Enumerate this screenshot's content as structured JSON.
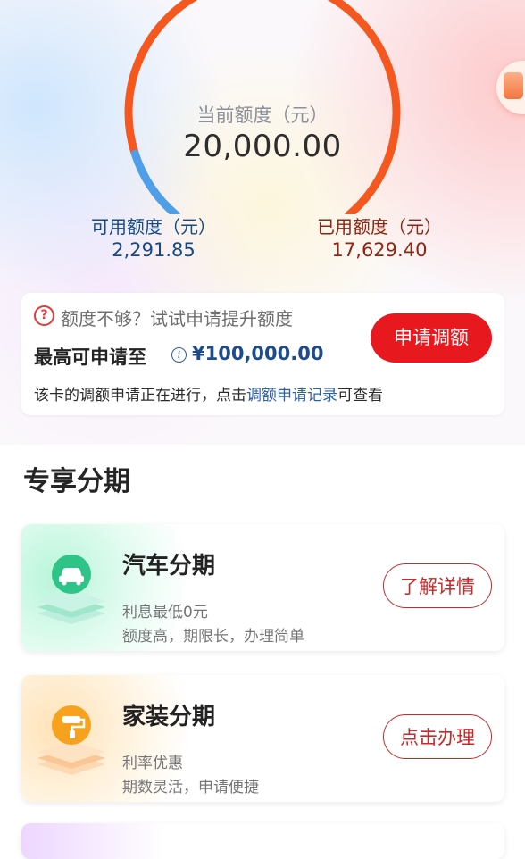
{
  "credit": {
    "current_label": "当前额度（元）",
    "current_value": "20,000.00",
    "available_label": "可用额度（元）",
    "available_value": "2,291.85",
    "used_label": "已用额度（元）",
    "used_value": "17,629.40",
    "available_fraction": 0.1146,
    "colors": {
      "used_arc": "#f4581f",
      "available_arc": "#4f9ee8"
    }
  },
  "limit_card": {
    "hint": "额度不够？试试申请提升额度",
    "max_label": "最高可申请至",
    "max_value": "¥100,000.00",
    "status_prefix": "该卡的调额申请正在进行，点击",
    "status_link": "调额申请记录",
    "status_suffix": "可查看",
    "button_label": "申请调额",
    "button_color": "#e8181f"
  },
  "section": {
    "title": "专享分期"
  },
  "plans": [
    {
      "icon": "car-icon",
      "name": "汽车分期",
      "line1": "利息最低0元",
      "line2": "额度高，期限长，办理简单",
      "button": "了解详情",
      "accent": "#2ec488"
    },
    {
      "icon": "paint-roller-icon",
      "name": "家装分期",
      "line1": "利率优惠",
      "line2": "期数灵活，申请便捷",
      "button": "点击办理",
      "accent": "#f7a21e"
    }
  ]
}
